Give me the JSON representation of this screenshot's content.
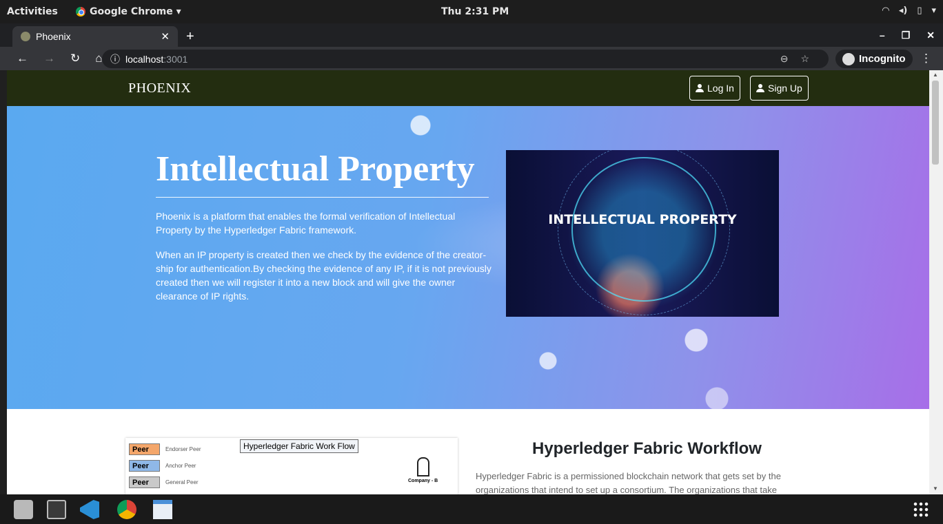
{
  "system_bar": {
    "activities": "Activities",
    "app_name": "Google Chrome ▾",
    "clock": "Thu  2:31 PM",
    "tray_icons": [
      "wifi-icon",
      "volume-icon",
      "battery-icon",
      "dropdown-icon"
    ]
  },
  "browser": {
    "tab_title": "Phoenix",
    "new_tab": "+",
    "url_host": "localhost",
    "url_port": ":3001",
    "incognito_label": "Incognito"
  },
  "site": {
    "brand": "PHOENIX",
    "login_label": "Log In",
    "signup_label": "Sign Up"
  },
  "hero": {
    "title": "Intellectual Property",
    "paragraph_1": "Phoenix is a platform that enables the formal verification of Intellectual Property by the Hyperledger Fabric framework.",
    "paragraph_2": "When an IP property is created then we check by the evidence of the creator-ship for authentication.By checking the evidence of any IP, if it is not previously created then we will register it into a new block and will give the owner clearance of IP rights.",
    "image_caption": "INTELLECTUAL PROPERTY"
  },
  "workflow": {
    "diagram_title": "Hyperledger Fabric Work Flow",
    "legend": [
      {
        "peer": "Peer",
        "desc": "Endorser Peer",
        "color": "#f4a66a"
      },
      {
        "peer": "Peer",
        "desc": "Anchor Peer",
        "color": "#8fb8e8"
      },
      {
        "peer": "Peer",
        "desc": "General Peer",
        "color": "#c9c9c9"
      }
    ],
    "company_label": "Company - B",
    "section_title": "Hyperledger Fabric Workflow",
    "section_text": "Hyperledger Fabric is a permissioned blockchain network that gets set by the organizations that intend to set up a consortium. The organizations that take"
  },
  "dock": {
    "apps": [
      "files-icon",
      "terminal-icon",
      "vscode-icon",
      "chrome-icon",
      "text-editor-icon"
    ],
    "apps_grid": "show-applications-icon"
  },
  "colors": {
    "site_nav": "#232d10",
    "hero_start": "#5aa9f0",
    "hero_end": "#a76ee8"
  }
}
